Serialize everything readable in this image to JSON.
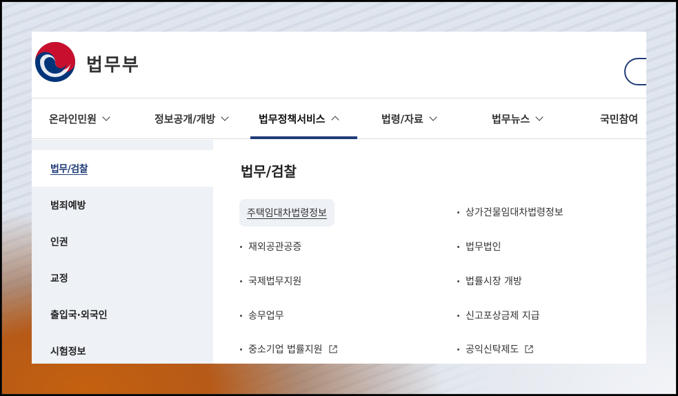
{
  "brand": {
    "name": "법무부"
  },
  "gnb": [
    {
      "label": "온라인민원",
      "active": false
    },
    {
      "label": "정보공개/개방",
      "active": false
    },
    {
      "label": "법무정책서비스",
      "active": true
    },
    {
      "label": "법령/자료",
      "active": false
    },
    {
      "label": "법무뉴스",
      "active": false
    },
    {
      "label": "국민참여",
      "active": false
    }
  ],
  "side": [
    {
      "label": "법무/검찰",
      "active": true
    },
    {
      "label": "범죄예방"
    },
    {
      "label": "인권"
    },
    {
      "label": "교정"
    },
    {
      "label": "출입국·외국인"
    },
    {
      "label": "시험정보"
    }
  ],
  "content": {
    "title": "법무/검찰",
    "links": [
      {
        "label": "주택임대차법령정보",
        "highlighted": true
      },
      {
        "label": "상가건물임대차법령정보"
      },
      {
        "label": "재외공관공증"
      },
      {
        "label": "법무법인"
      },
      {
        "label": "국제법무지원"
      },
      {
        "label": "법률시장 개방"
      },
      {
        "label": "송무업무"
      },
      {
        "label": "신고포상금제 지급"
      },
      {
        "label": "중소기업 법률지원",
        "external": true,
        "icon": "external-link-icon"
      },
      {
        "label": "공익신탁제도",
        "external": true,
        "icon": "external-link-icon"
      }
    ]
  },
  "colors": {
    "primary": "#1f3b77",
    "taeguk_red": "#c8102e",
    "taeguk_blue": "#003478"
  }
}
